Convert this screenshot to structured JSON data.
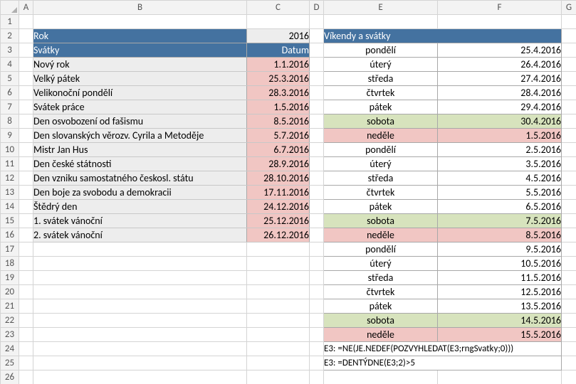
{
  "columns": [
    "A",
    "B",
    "C",
    "D",
    "E",
    "F",
    "G"
  ],
  "rowCount": 26,
  "holidays": {
    "yearLabel": "Rok",
    "yearValue": "2016",
    "header1": "Svátky",
    "header2": "Datum",
    "rows": [
      {
        "name": "Nový rok",
        "date": "1.1.2016"
      },
      {
        "name": "Velký pátek",
        "date": "25.3.2016"
      },
      {
        "name": "Velikonoční pondělí",
        "date": "28.3.2016"
      },
      {
        "name": "Svátek práce",
        "date": "1.5.2016"
      },
      {
        "name": "Den osvobození od fašismu",
        "date": "8.5.2016"
      },
      {
        "name": "Den slovanských věrozv. Cyrila a Metoděje",
        "date": "5.7.2016"
      },
      {
        "name": "Mistr Jan Hus",
        "date": "6.7.2016"
      },
      {
        "name": "Den české státnosti",
        "date": "28.9.2016"
      },
      {
        "name": "Den vzniku samostatného českosl. státu",
        "date": "28.10.2016"
      },
      {
        "name": "Den boje za svobodu a demokracii",
        "date": "17.11.2016"
      },
      {
        "name": "Štědrý den",
        "date": "24.12.2016"
      },
      {
        "name": "1. svátek vánoční",
        "date": "25.12.2016"
      },
      {
        "name": "2. svátek vánoční",
        "date": "26.12.2016"
      }
    ]
  },
  "calendar": {
    "header": "Víkendy a svátky",
    "rows": [
      {
        "day": "pondělí",
        "date": "25.4.2016",
        "cls": ""
      },
      {
        "day": "úterý",
        "date": "26.4.2016",
        "cls": ""
      },
      {
        "day": "středa",
        "date": "27.4.2016",
        "cls": ""
      },
      {
        "day": "čtvrtek",
        "date": "28.4.2016",
        "cls": ""
      },
      {
        "day": "pátek",
        "date": "29.4.2016",
        "cls": ""
      },
      {
        "day": "sobota",
        "date": "30.4.2016",
        "cls": "sat"
      },
      {
        "day": "neděle",
        "date": "1.5.2016",
        "cls": "sun"
      },
      {
        "day": "pondělí",
        "date": "2.5.2016",
        "cls": ""
      },
      {
        "day": "úterý",
        "date": "3.5.2016",
        "cls": ""
      },
      {
        "day": "středa",
        "date": "4.5.2016",
        "cls": ""
      },
      {
        "day": "čtvrtek",
        "date": "5.5.2016",
        "cls": ""
      },
      {
        "day": "pátek",
        "date": "6.5.2016",
        "cls": ""
      },
      {
        "day": "sobota",
        "date": "7.5.2016",
        "cls": "sat"
      },
      {
        "day": "neděle",
        "date": "8.5.2016",
        "cls": "sun"
      },
      {
        "day": "pondělí",
        "date": "9.5.2016",
        "cls": ""
      },
      {
        "day": "úterý",
        "date": "10.5.2016",
        "cls": ""
      },
      {
        "day": "středa",
        "date": "11.5.2016",
        "cls": ""
      },
      {
        "day": "čtvrtek",
        "date": "12.5.2016",
        "cls": ""
      },
      {
        "day": "pátek",
        "date": "13.5.2016",
        "cls": ""
      },
      {
        "day": "sobota",
        "date": "14.5.2016",
        "cls": "sat"
      },
      {
        "day": "neděle",
        "date": "15.5.2016",
        "cls": "sun"
      }
    ]
  },
  "formulas": {
    "f1": "E3: =NE(JE.NEDEF(POZVYHLEDAT(E3;rngSvatky;0)))",
    "f2": "E3: =DENTÝDNE(E3;2)>5"
  },
  "colors": {
    "headerBlue": "#4472a0",
    "pink": "#f1c6c3",
    "green": "#d7e3bd",
    "lightGray": "#ededed"
  }
}
